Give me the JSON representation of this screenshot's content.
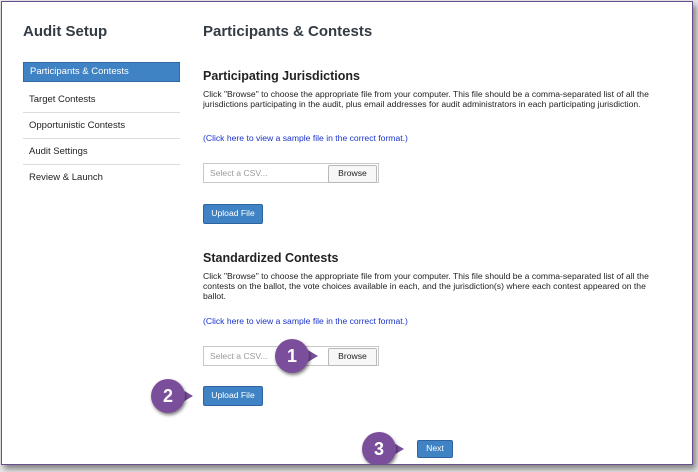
{
  "sidebar": {
    "title": "Audit Setup",
    "items": [
      {
        "label": "Participants & Contests"
      },
      {
        "label": "Target Contests"
      },
      {
        "label": "Opportunistic Contests"
      },
      {
        "label": "Audit Settings"
      },
      {
        "label": "Review & Launch"
      }
    ]
  },
  "main": {
    "title": "Participants & Contests",
    "jurisdictions": {
      "heading": "Participating Jurisdictions",
      "description": "Click \"Browse\" to choose the appropriate file from your computer. This file should be a comma-separated list of all the jurisdictions participating in the audit, plus email addresses for audit administrators in each participating jurisdiction.",
      "sample_link": "(Click here to view a sample file in the correct format.)",
      "file_placeholder": "Select a CSV...",
      "browse_label": "Browse",
      "upload_label": "Upload File"
    },
    "contests": {
      "heading": "Standardized Contests",
      "description": "Click \"Browse\" to choose the appropriate file from your computer. This file should be a comma-separated list of all the contests on the ballot, the vote choices available in each, and the jurisdiction(s) where each contest appeared on the ballot.",
      "sample_link": "(Click here to view a sample file in the correct format.)",
      "file_placeholder": "Select a CSV...",
      "browse_label": "Browse",
      "upload_label": "Upload File"
    },
    "next_label": "Next"
  },
  "callouts": [
    "1",
    "2",
    "3"
  ],
  "colors": {
    "accent": "#3f83c4",
    "callout": "#7b4e9b",
    "link": "#1a33cc"
  }
}
